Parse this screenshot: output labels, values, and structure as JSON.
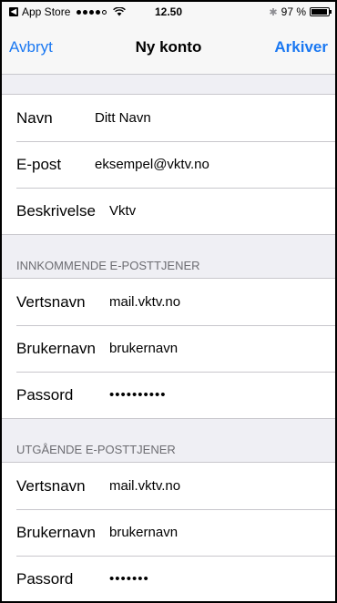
{
  "status_bar": {
    "back_app": "App Store",
    "signal_dots_filled": 4,
    "signal_dots_total": 5,
    "time": "12.50",
    "battery_text": "97 %",
    "battery_level": 0.97
  },
  "nav": {
    "left_label": "Avbryt",
    "title": "Ny konto",
    "right_label": "Arkiver"
  },
  "account": {
    "rows": [
      {
        "label": "Navn",
        "value": "Ditt Navn"
      },
      {
        "label": "E-post",
        "value": "eksempel@vktv.no"
      },
      {
        "label": "Beskrivelse",
        "value": "Vktv"
      }
    ]
  },
  "incoming": {
    "header": "INNKOMMENDE E-POSTTJENER",
    "host_label": "Vertsnavn",
    "host_value": "mail.vktv.no",
    "user_label": "Brukernavn",
    "user_value": "brukernavn",
    "pass_label": "Passord",
    "pass_value": "••••••••••"
  },
  "outgoing": {
    "header": "UTGÅENDE E-POSTTJENER",
    "host_label": "Vertsnavn",
    "host_value": "mail.vktv.no",
    "user_label": "Brukernavn",
    "user_value": "brukernavn",
    "pass_label": "Passord",
    "pass_value": "•••••••"
  },
  "colors": {
    "accent": "#1a78f2",
    "background": "#efeff4",
    "header_text": "#6d6d72",
    "separator": "#c8c7cc"
  }
}
